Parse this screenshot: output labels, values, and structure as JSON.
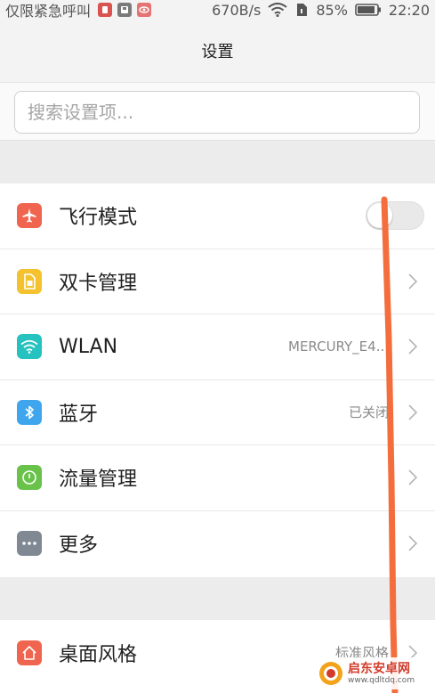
{
  "status_bar": {
    "carrier": "仅限紧急呼叫",
    "speed": "670B/s",
    "battery": "85%",
    "time": "22:20"
  },
  "header": {
    "title": "设置"
  },
  "search": {
    "placeholder": "搜索设置项...",
    "value": ""
  },
  "settings_list": {
    "items": [
      {
        "label": "飞行模式",
        "icon": "airplane-icon",
        "color": "#f0654f",
        "toggle_on": false
      },
      {
        "label": "双卡管理",
        "icon": "sim-card-icon",
        "color": "#f4c22f"
      },
      {
        "label": "WLAN",
        "icon": "wifi-icon",
        "color": "#25c2c0",
        "value": "MERCURY_E4..."
      },
      {
        "label": "蓝牙",
        "icon": "bluetooth-icon",
        "color": "#3fa6ee",
        "value": "已关闭"
      },
      {
        "label": "流量管理",
        "icon": "data-usage-icon",
        "color": "#69c34a"
      },
      {
        "label": "更多",
        "icon": "more-icon",
        "color": "#7f8893"
      }
    ]
  },
  "second_list": {
    "items": [
      {
        "label": "桌面风格",
        "icon": "home-icon",
        "color": "#f0654f",
        "value": "标准风格"
      }
    ]
  },
  "watermark": {
    "title": "启东安卓网",
    "url": "www.qdltdq.com"
  },
  "colors": {
    "swipe_stroke": "#f46d3c",
    "background": "#f3f3f3"
  }
}
